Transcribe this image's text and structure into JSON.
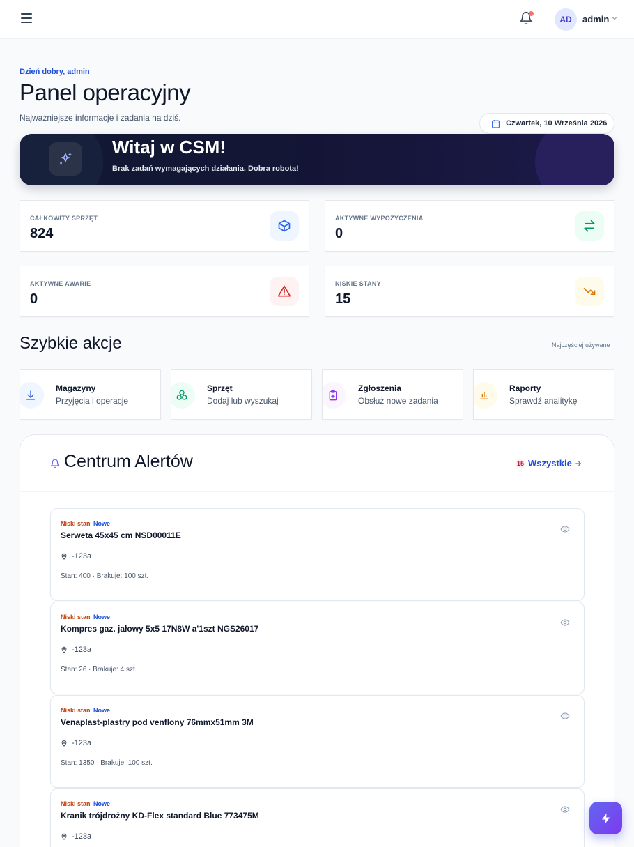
{
  "topbar": {
    "user_initials": "AD",
    "user_name": "admin",
    "notification_dot_color": "#f87171"
  },
  "header": {
    "greeting": "Dzień dobry, admin",
    "title": "Panel operacyjny",
    "subtitle": "Najważniejsze informacje i zadania na dziś.",
    "date": "Czwartek, 10 Września 2026"
  },
  "banner": {
    "title": "Witaj w CSM!",
    "subtitle": "Brak zadań wymagających działania. Dobra robota!",
    "icon": "sparkles-icon"
  },
  "stats": [
    {
      "label": "CAŁKOWITY SPRZĘT",
      "value": "824",
      "icon": "box-icon",
      "color": "#2563eb"
    },
    {
      "label": "AKTYWNE WYPOŻYCZENIA",
      "value": "0",
      "icon": "transfer-arrows-icon",
      "color": "#059669"
    },
    {
      "label": "AKTYWNE AWARIE",
      "value": "0",
      "icon": "warning-triangle-icon",
      "color": "#dc2626"
    },
    {
      "label": "NISKIE STANY",
      "value": "15",
      "icon": "trending-down-icon",
      "color": "#d97706"
    }
  ],
  "quick_actions": {
    "title": "Szybkie akcje",
    "hint": "Najczęściej używane",
    "items": [
      {
        "title": "Magazyny",
        "subtitle": "Przyjęcia i operacje",
        "icon": "download-icon",
        "color": "#2563eb"
      },
      {
        "title": "Sprzęt",
        "subtitle": "Dodaj lub wyszukaj",
        "icon": "boxes-icon",
        "color": "#059669"
      },
      {
        "title": "Zgłoszenia",
        "subtitle": "Obsłuż nowe zadania",
        "icon": "clipboard-plus-icon",
        "color": "#9333ea"
      },
      {
        "title": "Raporty",
        "subtitle": "Sprawdź analitykę",
        "icon": "bar-chart-icon",
        "color": "#d97706"
      }
    ]
  },
  "alerts": {
    "title": "Centrum Alertów",
    "count": "15",
    "view_all": "Wszystkie",
    "items": [
      {
        "tag_type": "Niski stan",
        "tag_status": "Nowe",
        "name": "Serweta 45x45 cm NSD00011E",
        "location": "-123a",
        "stock": "Stan: 400 · Brakuje: 100 szt."
      },
      {
        "tag_type": "Niski stan",
        "tag_status": "Nowe",
        "name": "Kompres gaz. jałowy 5x5 17N8W a'1szt NGS26017",
        "location": "-123a",
        "stock": "Stan: 26 · Brakuje: 4 szt."
      },
      {
        "tag_type": "Niski stan",
        "tag_status": "Nowe",
        "name": "Venaplast-plastry pod venflony 76mmx51mm 3M",
        "location": "-123a",
        "stock": "Stan: 1350 · Brakuje: 100 szt."
      },
      {
        "tag_type": "Niski stan",
        "tag_status": "Nowe",
        "name": "Kranik trójdrożny KD-Flex standard Blue 773475M",
        "location": "-123a",
        "stock": ""
      }
    ]
  }
}
